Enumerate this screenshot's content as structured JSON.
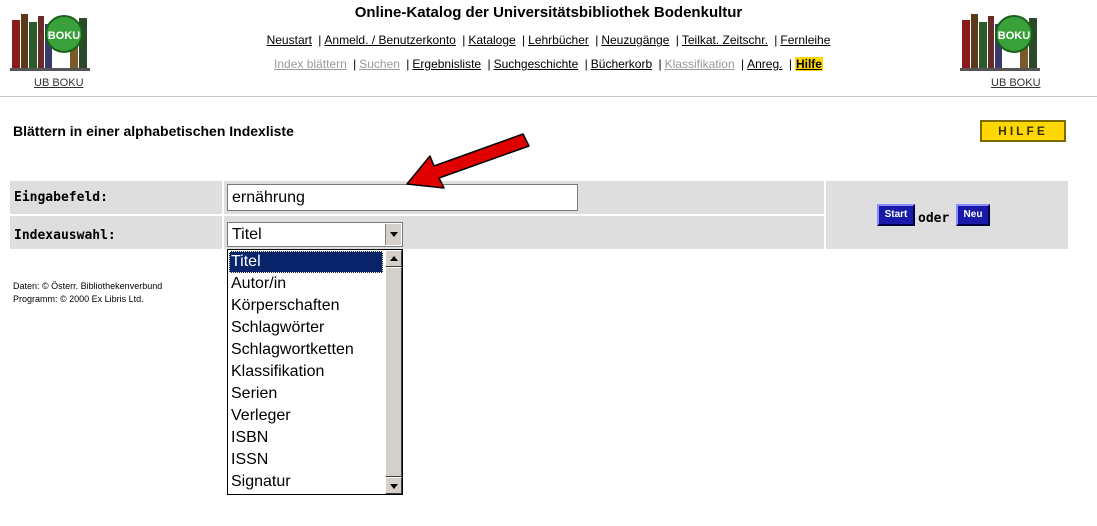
{
  "header": {
    "title": "Online-Katalog der Universitätsbibliothek Bodenkultur",
    "logo_caption_left": "UB BOKU",
    "logo_caption_right": "UB BOKU",
    "logo_badge": "BOKU",
    "nav_row1": [
      "Neustart",
      "Anmeld. / Benutzerkonto",
      "Kataloge",
      "Lehrbücher",
      "Neuzugänge",
      "Teilkat. Zeitschr.",
      "Fernleihe"
    ],
    "nav_row2": [
      "Index blättern",
      "Suchen",
      "Ergebnisliste",
      "Suchgeschichte",
      "Bücherkorb",
      "Klassifikation",
      "Anreg.",
      "Hilfe"
    ],
    "nav_separator": "|"
  },
  "page": {
    "heading": "Blättern in einer alphabetischen Indexliste",
    "help_button": "HILFE"
  },
  "form": {
    "input_label": "Eingabefeld:",
    "input_value": "ernährung",
    "select_label": "Indexauswahl:",
    "select_value": "Titel",
    "start_button": "Start",
    "oder": "oder",
    "neu_button": "Neu"
  },
  "footer": {
    "line1": "Daten: © Österr. Bibliothekenverbund",
    "line2": "Programm: © 2000 Ex Libris Ltd."
  },
  "dropdown": {
    "options": [
      "Titel",
      "Autor/in",
      "Körperschaften",
      "Schlagwörter",
      "Schlagwortketten",
      "Klassifikation",
      "Serien",
      "Verleger",
      "ISBN",
      "ISSN",
      "Signatur"
    ],
    "selected_index": 0
  },
  "colors": {
    "hilfe_yellow": "#ffd700",
    "button_blue": "#1a1aa8",
    "form_gray": "#dedede",
    "selection_navy": "#0a246a",
    "annotation_arrow": "#e00000"
  }
}
